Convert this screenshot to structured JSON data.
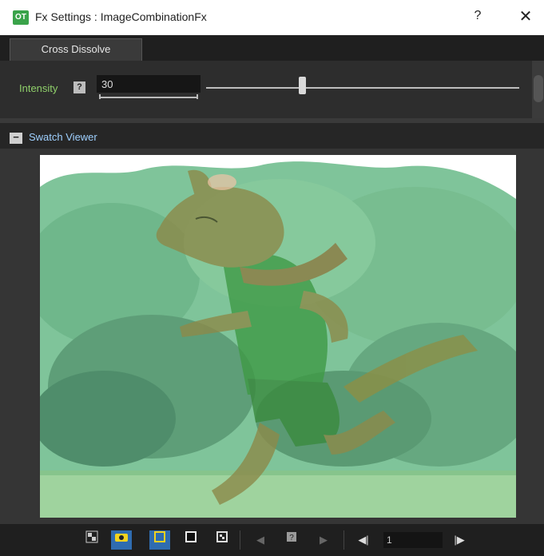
{
  "window": {
    "app_icon_text": "OT",
    "title": "Fx Settings : ImageCombinationFx",
    "help_label": "?",
    "close_label": "✕"
  },
  "tabs": [
    {
      "label": "Cross Dissolve",
      "active": true
    }
  ],
  "params": {
    "intensity": {
      "label": "Intensity",
      "help_icon": "?",
      "value": "30",
      "slider_fraction": 0.3
    }
  },
  "swatch_viewer": {
    "collapse_label": "−",
    "title": "Swatch Viewer"
  },
  "toolbar": {
    "frame_value": "1",
    "icons": [
      "transparency-check-icon",
      "preview-eye-icon",
      "white-bg-icon",
      "black-bg-icon",
      "checkerboard-bg-icon",
      "prev-key-icon",
      "key-icon",
      "next-key-icon",
      "prev-frame-icon",
      "next-frame-icon"
    ]
  },
  "colors": {
    "accent": "#2f6cb0",
    "param_label": "#8fcf6a",
    "viewer_title": "#9fd0ff"
  }
}
